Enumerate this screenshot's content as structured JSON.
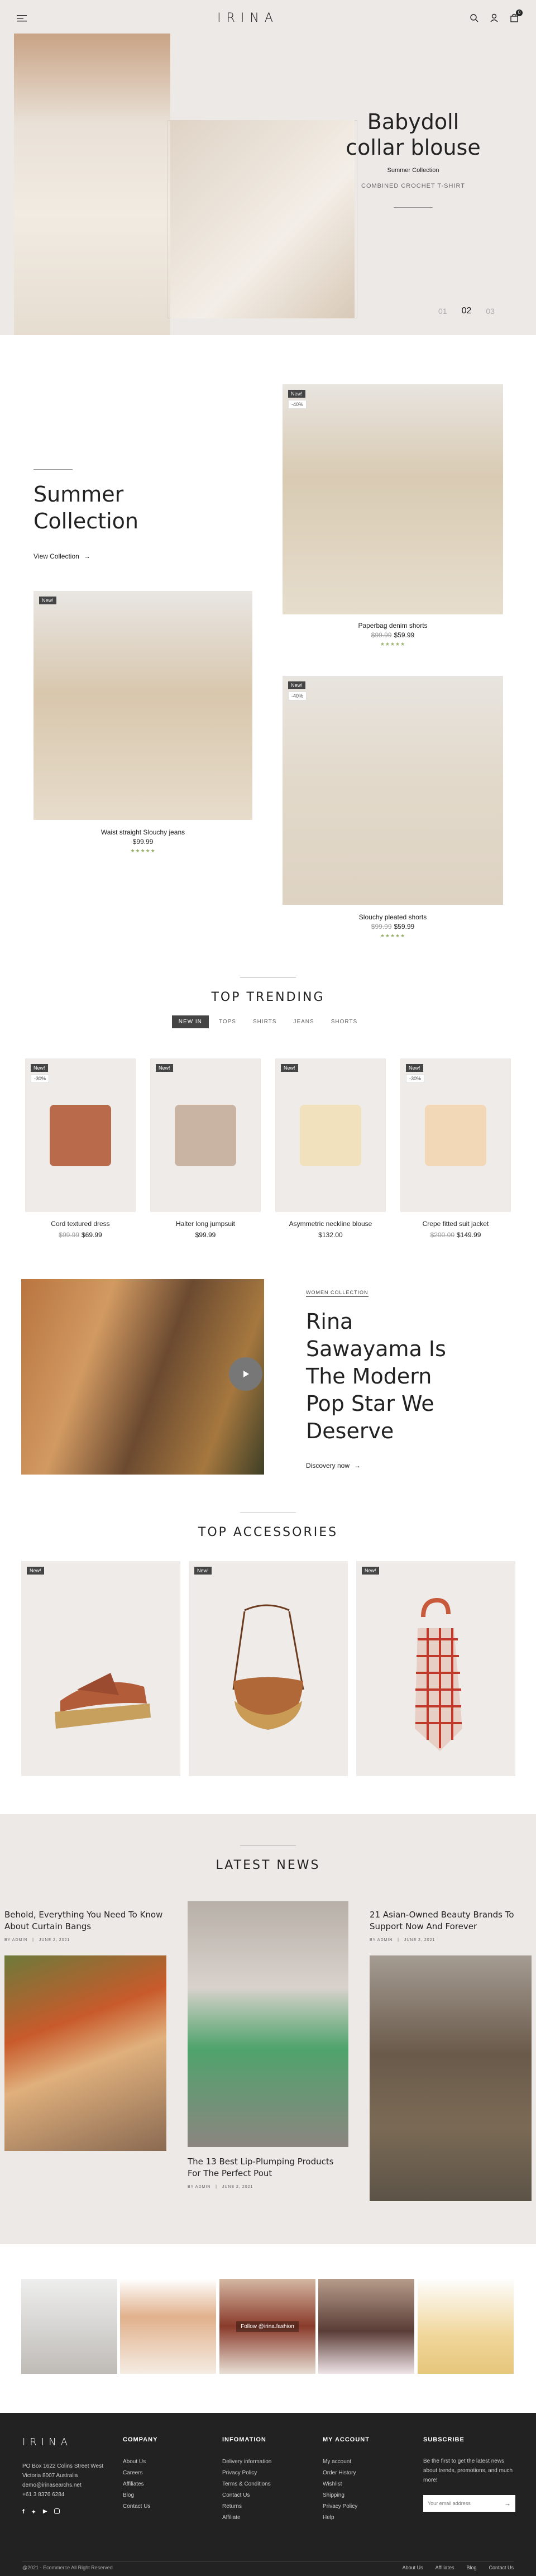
{
  "brand": "IRINA",
  "header": {
    "icons": [
      "search-icon",
      "user-icon",
      "bag-icon"
    ],
    "cart_count": "0"
  },
  "hero": {
    "title_1": "Babydoll",
    "title_2": "collar blouse",
    "subtitle": "Summer Collection",
    "tagline": "COMBINED CROCHET T-SHIRT",
    "pager_current": "02",
    "pager_prev": "01",
    "pager_next": "03"
  },
  "summer": {
    "heading_1": "Summer",
    "heading_2": "Collection",
    "link": "View Collection",
    "products": [
      {
        "badge": "New!",
        "percent": "-40%",
        "name": "Paperbag denim shorts",
        "old": "$99.99",
        "price": "$59.99"
      },
      {
        "badge": "New!",
        "name": "Waist straight Slouchy jeans",
        "price": "$99.99"
      },
      {
        "badge": "New!",
        "percent": "-40%",
        "name": "Slouchy pleated shorts",
        "old": "$99.99",
        "price": "$59.99"
      }
    ]
  },
  "trending": {
    "title": "TOP TRENDING",
    "tabs": [
      "NEW IN",
      "TOPS",
      "SHIRTS",
      "JEANS",
      "SHORTS"
    ],
    "products": [
      {
        "badge": "New!",
        "percent": "-30%",
        "name": "Cord textured dress",
        "old": "$99.99",
        "price": "$69.99",
        "color": "#b96a4b"
      },
      {
        "badge": "New!",
        "name": "Halter long jumpsuit",
        "price": "$99.99",
        "color": "#c9b4a4"
      },
      {
        "badge": "New!",
        "name": "Asymmetric neckline blouse",
        "price": "$132.00",
        "color": "#f2e1bd"
      },
      {
        "badge": "New!",
        "percent": "-30%",
        "name": "Crepe fitted suit jacket",
        "old": "$200.00",
        "price": "$149.99",
        "color": "#f2d8b7"
      }
    ]
  },
  "feature": {
    "eyebrow": "WOMEN COLLECTION",
    "title_1": "Rina",
    "title_2": "Sawayama Is",
    "title_3": "The Modern",
    "title_4": "Pop Star We",
    "title_5": "Deserve",
    "link": "Discovery now"
  },
  "accessories": {
    "title": "TOP ACCESSORIES",
    "badges": [
      "New!",
      "New!",
      "New!"
    ]
  },
  "news": {
    "title": "LATEST NEWS",
    "posts": [
      {
        "title": "Behold, Everything You Need To Know About Curtain Bangs",
        "author": "BY ADMIN",
        "date": "JUNE 2, 2021"
      },
      {
        "title": "The 13 Best Lip-Plumping Products For The Perfect Pout",
        "author": "BY ADMIN",
        "date": "JUNE 2, 2021"
      },
      {
        "title": "21 Asian-Owned Beauty Brands To Support Now And Forever",
        "author": "BY ADMIN",
        "date": "JUNE 2, 2021"
      }
    ]
  },
  "instagram": {
    "label": "Follow @irina.fashion"
  },
  "footer": {
    "address": "PO Box 1622 Colins Street West Victoria 8007 Australia",
    "email": "demo@irinasearchs.net",
    "phone": "+61 3 8376 6284",
    "company": {
      "title": "COMPANY",
      "links": [
        "About Us",
        "Careers",
        "Affiliates",
        "Blog",
        "Contact Us"
      ]
    },
    "information": {
      "title": "INFOMATION",
      "links": [
        "Delivery information",
        "Privacy Policy",
        "Terms & Conditions",
        "Contact Us",
        "Returns",
        "Affiliate"
      ]
    },
    "account": {
      "title": "MY ACCOUNT",
      "links": [
        "My account",
        "Order History",
        "Wishlist",
        "Shipping",
        "Privacy Policy",
        "Help"
      ]
    },
    "subscribe": {
      "title": "SUBSCRIBE",
      "text": "Be the first to get the latest news about trends, promotions, and much more!",
      "placeholder": "Your email address"
    },
    "copyright": "@2021 - Ecommerce All Right Reserved",
    "bottom_links": [
      "About Us",
      "Affiliates",
      "Blog",
      "Contact Us"
    ]
  }
}
